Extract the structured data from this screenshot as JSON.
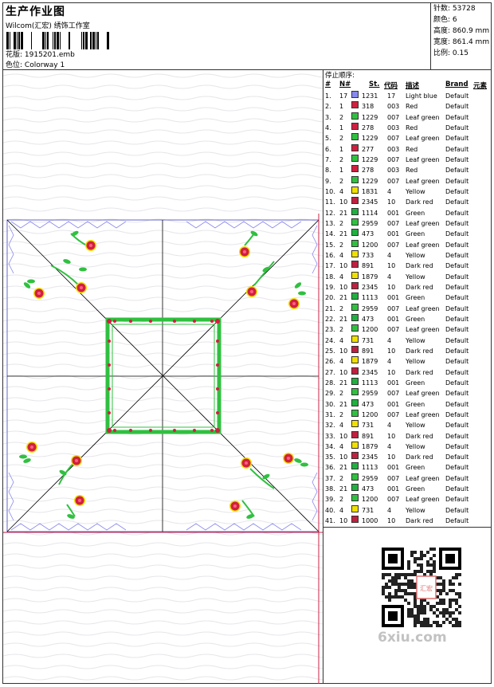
{
  "header": {
    "title": "生产作业图",
    "subtitle": "Wilcom(汇宏) 绣饰工作室",
    "design_label": "花版:",
    "design_value": "1915201.emb",
    "color_label": "色位:",
    "color_value": "Colorway 1"
  },
  "stats": {
    "stitches_label": "针数:",
    "stitches_value": "53728",
    "colors_label": "颜色:",
    "colors_value": "6",
    "height_label": "高度:",
    "height_value": "860.9 mm",
    "width_label": "宽度:",
    "width_value": "861.4 mm",
    "scale_label": "比例:",
    "scale_value": "0.15"
  },
  "stop_sequence": {
    "title": "停止顺序:",
    "columns": [
      "#",
      "N#",
      "St.",
      "代码",
      "描述",
      "Brand",
      "元素"
    ],
    "rows": [
      [
        "1.",
        "17",
        "1231",
        "17",
        "Light blue",
        "Default",
        "#8888ee"
      ],
      [
        "2.",
        "1",
        "318",
        "003",
        "Red",
        "Default",
        "#d02040"
      ],
      [
        "3.",
        "2",
        "1229",
        "007",
        "Leaf green",
        "Default",
        "#30c040"
      ],
      [
        "4.",
        "1",
        "278",
        "003",
        "Red",
        "Default",
        "#d02040"
      ],
      [
        "5.",
        "2",
        "1229",
        "007",
        "Leaf green",
        "Default",
        "#30c040"
      ],
      [
        "6.",
        "1",
        "277",
        "003",
        "Red",
        "Default",
        "#d02040"
      ],
      [
        "7.",
        "2",
        "1229",
        "007",
        "Leaf green",
        "Default",
        "#30c040"
      ],
      [
        "8.",
        "1",
        "278",
        "003",
        "Red",
        "Default",
        "#d02040"
      ],
      [
        "9.",
        "2",
        "1229",
        "007",
        "Leaf green",
        "Default",
        "#30c040"
      ],
      [
        "10.",
        "4",
        "1831",
        "4",
        "Yellow",
        "Default",
        "#f0e000"
      ],
      [
        "11.",
        "10",
        "2345",
        "10",
        "Dark red",
        "Default",
        "#c02040"
      ],
      [
        "12.",
        "21",
        "1114",
        "001",
        "Green",
        "Default",
        "#20b040"
      ],
      [
        "13.",
        "2",
        "2959",
        "007",
        "Leaf green",
        "Default",
        "#30c040"
      ],
      [
        "14.",
        "21",
        "473",
        "001",
        "Green",
        "Default",
        "#20b040"
      ],
      [
        "15.",
        "2",
        "1200",
        "007",
        "Leaf green",
        "Default",
        "#30c040"
      ],
      [
        "16.",
        "4",
        "733",
        "4",
        "Yellow",
        "Default",
        "#f0e000"
      ],
      [
        "17.",
        "10",
        "891",
        "10",
        "Dark red",
        "Default",
        "#c02040"
      ],
      [
        "18.",
        "4",
        "1879",
        "4",
        "Yellow",
        "Default",
        "#f0e000"
      ],
      [
        "19.",
        "10",
        "2345",
        "10",
        "Dark red",
        "Default",
        "#c02040"
      ],
      [
        "20.",
        "21",
        "1113",
        "001",
        "Green",
        "Default",
        "#20b040"
      ],
      [
        "21.",
        "2",
        "2959",
        "007",
        "Leaf green",
        "Default",
        "#30c040"
      ],
      [
        "22.",
        "21",
        "473",
        "001",
        "Green",
        "Default",
        "#20b040"
      ],
      [
        "23.",
        "2",
        "1200",
        "007",
        "Leaf green",
        "Default",
        "#30c040"
      ],
      [
        "24.",
        "4",
        "731",
        "4",
        "Yellow",
        "Default",
        "#f0e000"
      ],
      [
        "25.",
        "10",
        "891",
        "10",
        "Dark red",
        "Default",
        "#c02040"
      ],
      [
        "26.",
        "4",
        "1879",
        "4",
        "Yellow",
        "Default",
        "#f0e000"
      ],
      [
        "27.",
        "10",
        "2345",
        "10",
        "Dark red",
        "Default",
        "#c02040"
      ],
      [
        "28.",
        "21",
        "1113",
        "001",
        "Green",
        "Default",
        "#20b040"
      ],
      [
        "29.",
        "2",
        "2959",
        "007",
        "Leaf green",
        "Default",
        "#30c040"
      ],
      [
        "30.",
        "21",
        "473",
        "001",
        "Green",
        "Default",
        "#20b040"
      ],
      [
        "31.",
        "2",
        "1200",
        "007",
        "Leaf green",
        "Default",
        "#30c040"
      ],
      [
        "32.",
        "4",
        "731",
        "4",
        "Yellow",
        "Default",
        "#f0e000"
      ],
      [
        "33.",
        "10",
        "891",
        "10",
        "Dark red",
        "Default",
        "#c02040"
      ],
      [
        "34.",
        "4",
        "1879",
        "4",
        "Yellow",
        "Default",
        "#f0e000"
      ],
      [
        "35.",
        "10",
        "2345",
        "10",
        "Dark red",
        "Default",
        "#c02040"
      ],
      [
        "36.",
        "21",
        "1113",
        "001",
        "Green",
        "Default",
        "#20b040"
      ],
      [
        "37.",
        "2",
        "2959",
        "007",
        "Leaf green",
        "Default",
        "#30c040"
      ],
      [
        "38.",
        "21",
        "473",
        "001",
        "Green",
        "Default",
        "#20b040"
      ],
      [
        "39.",
        "2",
        "1200",
        "007",
        "Leaf green",
        "Default",
        "#30c040"
      ],
      [
        "40.",
        "4",
        "731",
        "4",
        "Yellow",
        "Default",
        "#f0e000"
      ],
      [
        "41.",
        "10",
        "1000",
        "10",
        "Dark red",
        "Default",
        "#c02040"
      ]
    ]
  },
  "watermark": "6xiu.com",
  "qr_seal_text": "汇宏"
}
